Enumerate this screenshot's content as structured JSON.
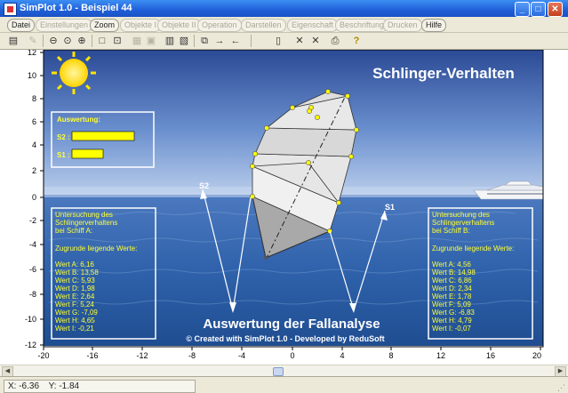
{
  "window": {
    "title": "SimPlot 1.0 - Beispiel 44",
    "minimize": "_",
    "maximize": "□",
    "close": "✕"
  },
  "menu": [
    {
      "label": "Datei",
      "enabled": true
    },
    {
      "label": "Einstellungen",
      "enabled": false
    },
    {
      "label": "Zoom",
      "enabled": true
    },
    {
      "label": "Objekte I",
      "enabled": false
    },
    {
      "label": "Objekte II",
      "enabled": false
    },
    {
      "label": "Operation",
      "enabled": false
    },
    {
      "label": "Darstellen",
      "enabled": false
    },
    {
      "label": "Eigenschaft",
      "enabled": false
    },
    {
      "label": "Beschriftung",
      "enabled": false
    },
    {
      "label": "Drucken",
      "enabled": false
    },
    {
      "label": "Hilfe",
      "enabled": true
    }
  ],
  "toolbar_icons": [
    "calculator-icon",
    "pen-icon",
    "zoom-out-icon",
    "zoom-icon",
    "zoom-in-icon",
    "square-icon",
    "fit-icon",
    "grid-icon",
    "layers-icon",
    "table-icon",
    "chart-icon",
    "copy-icon",
    "arrow-right-icon",
    "arrow-left-icon",
    "page-icon",
    "cross-icon",
    "cross-alt-icon",
    "printer-icon",
    "help-icon"
  ],
  "plot": {
    "title": "Schlinger-Verhalten",
    "subtitle": "Auswertung der Fallanalyse",
    "credit": "© Created with SimPlot 1.0 - Developed by ReduSoft",
    "label_s1": "S1",
    "label_s2": "S2",
    "x_ticks": [
      "-20",
      "-16",
      "-12",
      "-8",
      "-4",
      "0",
      "4",
      "8",
      "12",
      "16",
      "20"
    ],
    "y_ticks": [
      "12",
      "10",
      "8",
      "6",
      "4",
      "2",
      "0",
      "-2",
      "-4",
      "-6",
      "-8",
      "-10",
      "-12"
    ],
    "colors": {
      "panel_text": "#ffff33",
      "bar": "#ffff00",
      "frame": "#ffffff",
      "sky_top": "#2f4e96",
      "sea": "#2f5fa8"
    }
  },
  "auswertung": {
    "title": "Auswertung:",
    "s2_label": "S2 :",
    "s1_label": "S1 :",
    "s2_level": 1.0,
    "s1_level": 0.5
  },
  "left_panel": {
    "heading_lines": [
      "Untersuchung des",
      "Schlingerverhaltens",
      "bei Schiff A:"
    ],
    "values_title": "Zugrunde liegende Werte:",
    "values": [
      "Wert A: 6,16",
      "Wert B: 13,58",
      "Wert C: 5,93",
      "Wert D: 1,98",
      "Wert E: 2,64",
      "Wert F: 5,24",
      "Wert G: -7,09",
      "Wert H: 4,65",
      "Wert I: -0,21"
    ]
  },
  "right_panel": {
    "heading_lines": [
      "Untersuchung des",
      "Schlingerverhaltens",
      "bei Schiff B:"
    ],
    "values_title": "Zugrunde liegende Werte:",
    "values": [
      "Wert A: 4,56",
      "Wert B: 14,98",
      "Wert C: 6,86",
      "Wert D: 2,34",
      "Wert E: 1,78",
      "Wert F: 5,09",
      "Wert G: -6,83",
      "Wert H: 4,79",
      "Wert I: -0,07"
    ]
  },
  "status": {
    "x": "X: -6.36",
    "y": "Y: -1.84"
  }
}
